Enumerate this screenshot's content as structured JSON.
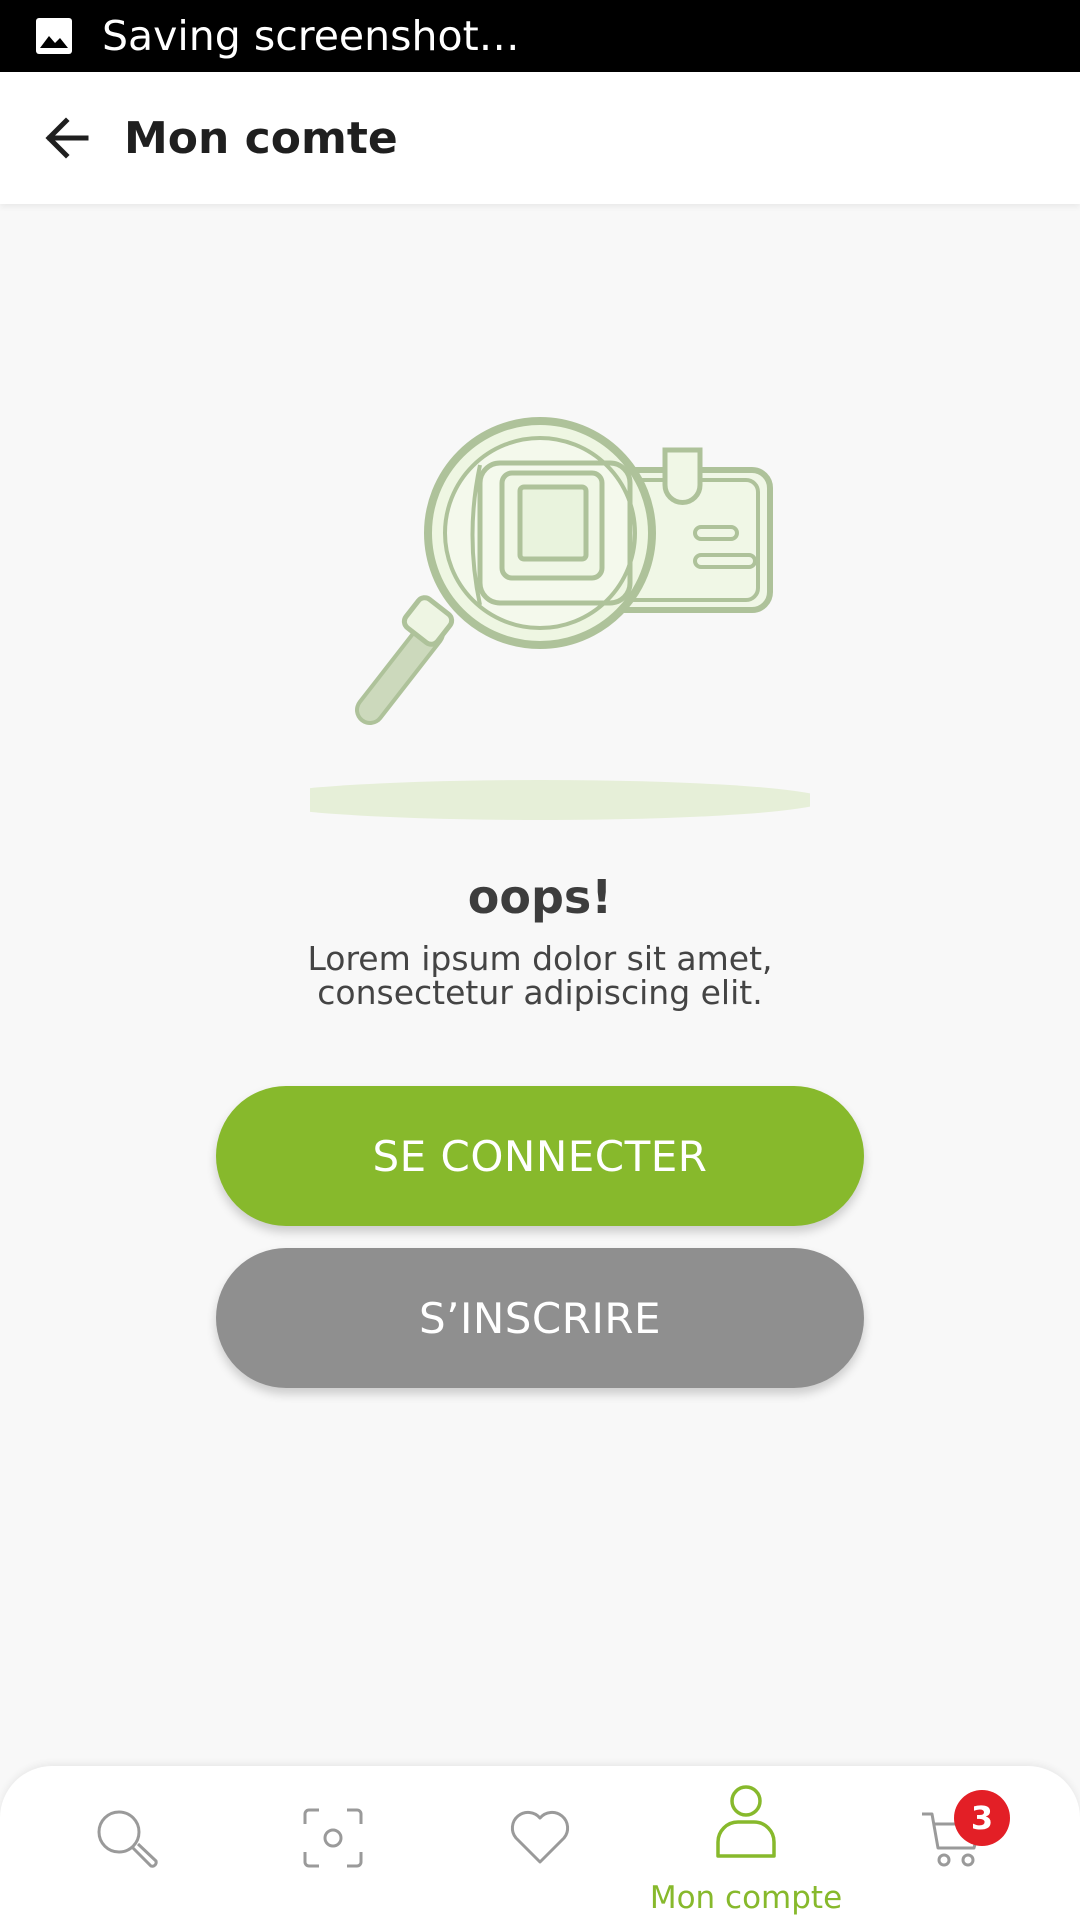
{
  "status_bar": {
    "text": "Saving screenshot…",
    "icon": "image-icon"
  },
  "app_bar": {
    "title": "Mon comte",
    "back_icon": "arrow-back-icon"
  },
  "empty_state": {
    "illustration": "magnifier-id-card-illustration",
    "heading": "oops!",
    "line1": "Lorem ipsum dolor sit amet,",
    "line2": "consectetur adipiscing elit."
  },
  "buttons": {
    "login": "SE CONNECTER",
    "signup": "S’INSCRIRE"
  },
  "bottom_nav": {
    "items": [
      {
        "icon": "search-icon",
        "label": ""
      },
      {
        "icon": "scan-icon",
        "label": ""
      },
      {
        "icon": "heart-icon",
        "label": ""
      },
      {
        "icon": "user-icon",
        "label": "Mon compte",
        "active": true
      },
      {
        "icon": "cart-icon",
        "label": "",
        "badge": "3"
      }
    ]
  },
  "colors": {
    "accent": "#87b92c",
    "secondary_button": "#8f8f8f",
    "badge": "#e31f26",
    "background": "#f8f8f8"
  }
}
